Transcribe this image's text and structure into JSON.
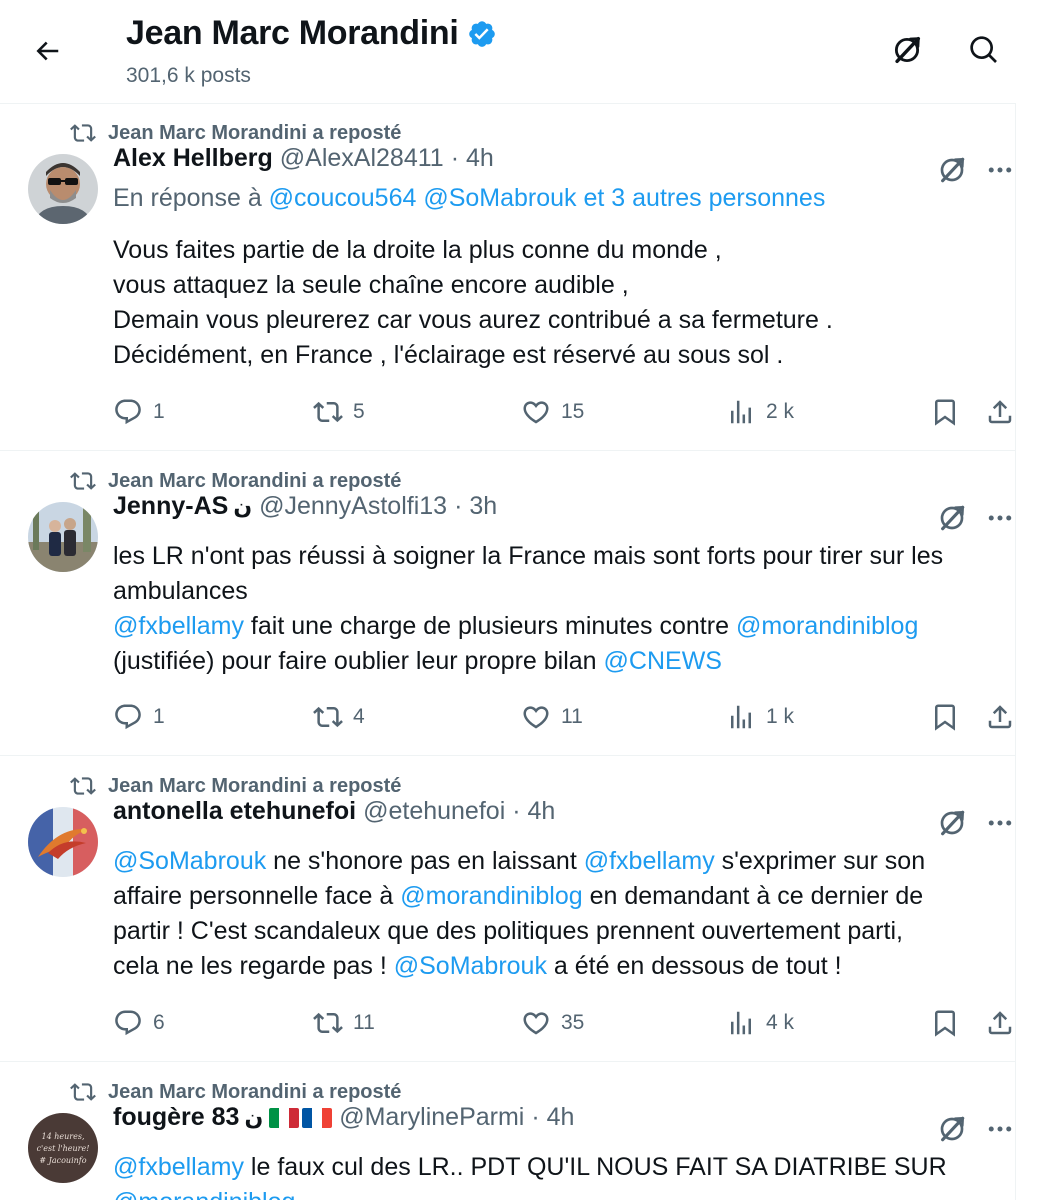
{
  "header": {
    "name": "Jean Marc Morandini",
    "post_count": "301,6 k posts"
  },
  "tweets": [
    {
      "repost_label": "Jean Marc Morandini a reposté",
      "name": "Alex Hellberg",
      "handle": "@AlexAl28411",
      "time": "· 4h",
      "reply_prefix": "En réponse à",
      "reply_handles": "@coucou564 @SoMabrouk",
      "reply_suffix": "et 3 autres personnes",
      "lines": [
        "Vous faites partie de la droite la plus conne du monde ,",
        "vous attaquez la seule chaîne encore audible ,",
        "Demain vous pleurerez car vous aurez contribué a sa fermeture .",
        "Décidément,  en France , l'éclairage est réservé au sous sol ."
      ],
      "replies": "1",
      "reposts": "5",
      "likes": "15",
      "views": "2 k"
    },
    {
      "repost_label": "Jean Marc Morandini a reposté",
      "name": "Jenny-AS",
      "name_suffix": "ن",
      "handle": "@JennyAstolfi13",
      "time": "· 3h",
      "l1": "les LR n'ont pas réussi à soigner la France mais sont forts pour tirer sur les",
      "l2": "ambulances",
      "l3_link1": "@fxbellamy",
      "l3_text": " fait une charge de plusieurs minutes contre ",
      "l3_link2": "@morandiniblog",
      "l4_text": "(justifiée) pour faire oublier leur propre bilan ",
      "l4_link": "@CNEWS",
      "replies": "1",
      "reposts": "4",
      "likes": "11",
      "views": "1 k"
    },
    {
      "repost_label": "Jean Marc Morandini a reposté",
      "name": "antonella etehunefoi",
      "handle": "@etehunefoi",
      "time": "· 4h",
      "l1_link": "@SoMabrouk",
      "l1_text1": " ne s'honore pas en laissant ",
      "l1_link2": "@fxbellamy",
      "l1_text2": " s'exprimer sur son",
      "l2_text1": "affaire personnelle face à ",
      "l2_link": "@morandiniblog",
      "l2_text2": " en demandant à ce dernier de",
      "l3": "partir ! C'est scandaleux que des politiques prennent ouvertement parti,",
      "l4_text1": "cela ne les regarde pas ! ",
      "l4_link": "@SoMabrouk",
      "l4_text2": " a été en dessous de tout !",
      "replies": "6",
      "reposts": "11",
      "likes": "35",
      "views": "4 k"
    },
    {
      "repost_label": "Jean Marc Morandini a reposté",
      "name": "fougère 83",
      "name_suffix": "ن",
      "handle": "@MarylineParmi",
      "time": "· 4h",
      "l1_link": "@fxbellamy",
      "l1_text": "  le faux cul des LR.. PDT QU'IL NOUS FAIT SA DIATRIBE SUR",
      "l2_link": "@morandiniblog",
      "avatar_text": "14 heures, c'est l'heure! # Jacouinfo"
    }
  ],
  "colors": {
    "accent": "#1d9bf0",
    "secondary_text": "#536471",
    "divider": "#eff3f4"
  }
}
